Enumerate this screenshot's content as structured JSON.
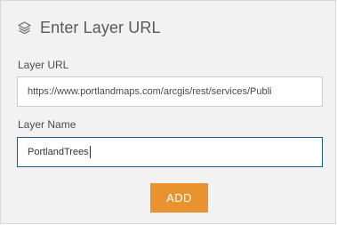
{
  "dialog": {
    "title": "Enter Layer URL",
    "icon": "layers-icon"
  },
  "fields": {
    "url_label": "Layer URL",
    "url_value": "https://www.portlandmaps.com/arcgis/rest/services/Publi",
    "name_label": "Layer Name",
    "name_value": "PortlandTrees"
  },
  "actions": {
    "add_label": "ADD"
  },
  "colors": {
    "accent": "#e8932f",
    "focus_border": "#1e5a87",
    "panel_bg": "#f2f2f2"
  }
}
